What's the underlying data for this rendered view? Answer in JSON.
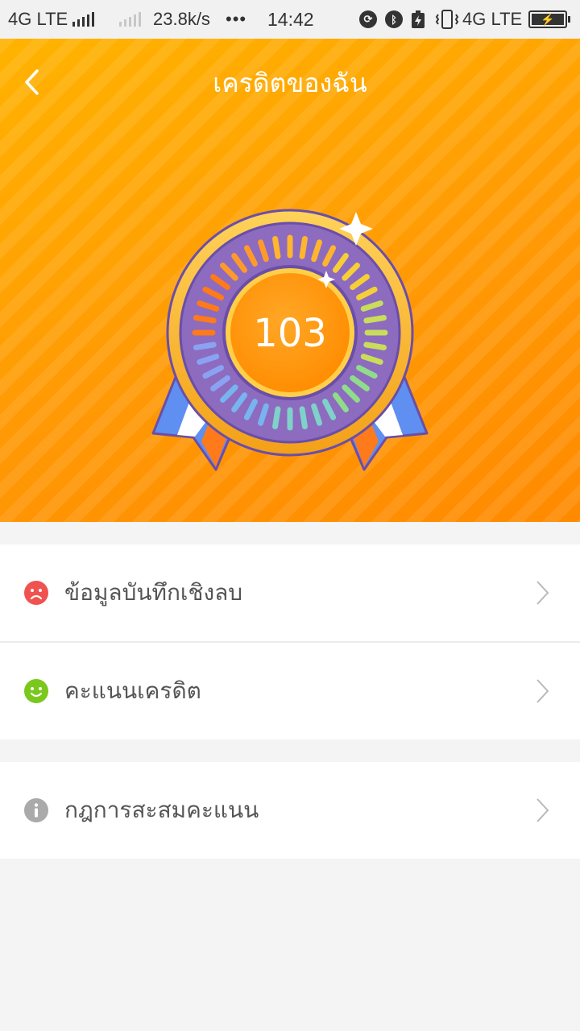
{
  "status_bar": {
    "network_left": "4G LTE",
    "speed": "23.8k/s",
    "more": "•••",
    "time": "14:42",
    "network_right": "4G LTE"
  },
  "header": {
    "title": "เครดิตของฉัน",
    "score": "103"
  },
  "menu": {
    "negative_records": "ข้อมูลบันทึกเชิงลบ",
    "credit_score": "คะแนนเครดิต",
    "points_rules": "กฎการสะสมคะแนน"
  },
  "colors": {
    "header_orange": "#ff9f0a",
    "medal_purple": "#8d6bbf",
    "sad_red": "#f0524f",
    "happy_green": "#7ac81d",
    "info_gray": "#aaaaaa"
  }
}
